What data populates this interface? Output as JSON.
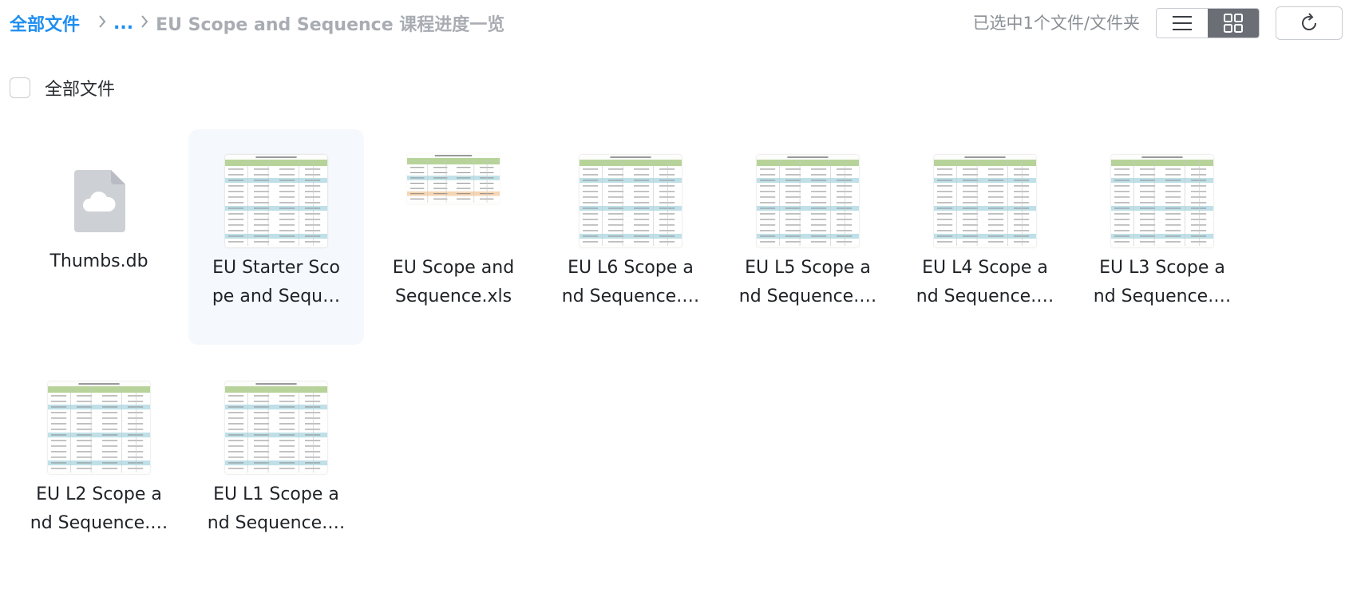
{
  "breadcrumb": {
    "root": "全部文件",
    "ellipsis": "...",
    "current": "EU Scope and Sequence 课程进度一览"
  },
  "toolbar": {
    "selected_text": "已选中1个文件/文件夹",
    "list_view_icon": "list-icon",
    "grid_view_icon": "grid-icon",
    "refresh_icon": "refresh-icon"
  },
  "select_all": {
    "label": "全部文件"
  },
  "files": [
    {
      "name_line1": "Thumbs.db",
      "name_line2": "",
      "icon": "cloud-file-icon",
      "selected": false
    },
    {
      "name_line1": "EU Starter Sco",
      "name_line2": "pe and Sequ…",
      "icon": "spreadsheet-thumbnail",
      "selected": true
    },
    {
      "name_line1": "EU Scope and",
      "name_line2": "Sequence.xls",
      "icon": "spreadsheet-thumbnail",
      "selected": false
    },
    {
      "name_line1": "EU L6 Scope a",
      "name_line2": "nd Sequence.…",
      "icon": "spreadsheet-thumbnail",
      "selected": false
    },
    {
      "name_line1": "EU L5 Scope a",
      "name_line2": "nd Sequence.…",
      "icon": "spreadsheet-thumbnail",
      "selected": false
    },
    {
      "name_line1": "EU L4 Scope a",
      "name_line2": "nd Sequence.…",
      "icon": "spreadsheet-thumbnail",
      "selected": false
    },
    {
      "name_line1": "EU L3 Scope a",
      "name_line2": "nd Sequence.…",
      "icon": "spreadsheet-thumbnail",
      "selected": false
    },
    {
      "name_line1": "EU L2 Scope a",
      "name_line2": "nd Sequence.…",
      "icon": "spreadsheet-thumbnail",
      "selected": false
    },
    {
      "name_line1": "EU L1 Scope a",
      "name_line2": "nd Sequence.…",
      "icon": "spreadsheet-thumbnail",
      "selected": false
    }
  ],
  "colors": {
    "accent": "#1f8ef1",
    "muted": "#a9adb3",
    "selected_bg": "#f5f8fc",
    "toggle_active": "#6b6f75"
  }
}
